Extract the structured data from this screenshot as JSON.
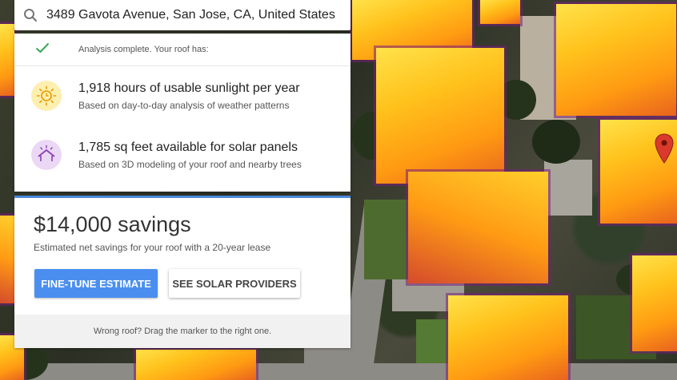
{
  "search": {
    "value": "3489 Gavota Avenue, San Jose, CA, United States"
  },
  "analysis": {
    "status_text": "Analysis complete. Your roof has:",
    "stats": [
      {
        "icon": "sun-icon",
        "title": "1,918 hours of usable sunlight per year",
        "subtitle": "Based on day-to-day analysis of weather patterns"
      },
      {
        "icon": "house-icon",
        "title": "1,785 sq feet available for solar panels",
        "subtitle": "Based on 3D modeling of your roof and nearby trees"
      }
    ]
  },
  "savings": {
    "title": "$14,000 savings",
    "subtitle": "Estimated net savings for your roof with a 20-year lease",
    "primary_button": "FINE-TUNE ESTIMATE",
    "secondary_button": "SEE SOLAR PROVIDERS",
    "footer": "Wrong roof? Drag the marker to the right one."
  },
  "colors": {
    "accent": "#4a8ff0",
    "check": "#34a853",
    "sun_bg": "#fdefb0",
    "house_bg": "#ead8f5",
    "heat_high": "#ffe24a",
    "heat_low": "#e8631e"
  },
  "map": {
    "marker_icon": "map-pin-icon"
  }
}
